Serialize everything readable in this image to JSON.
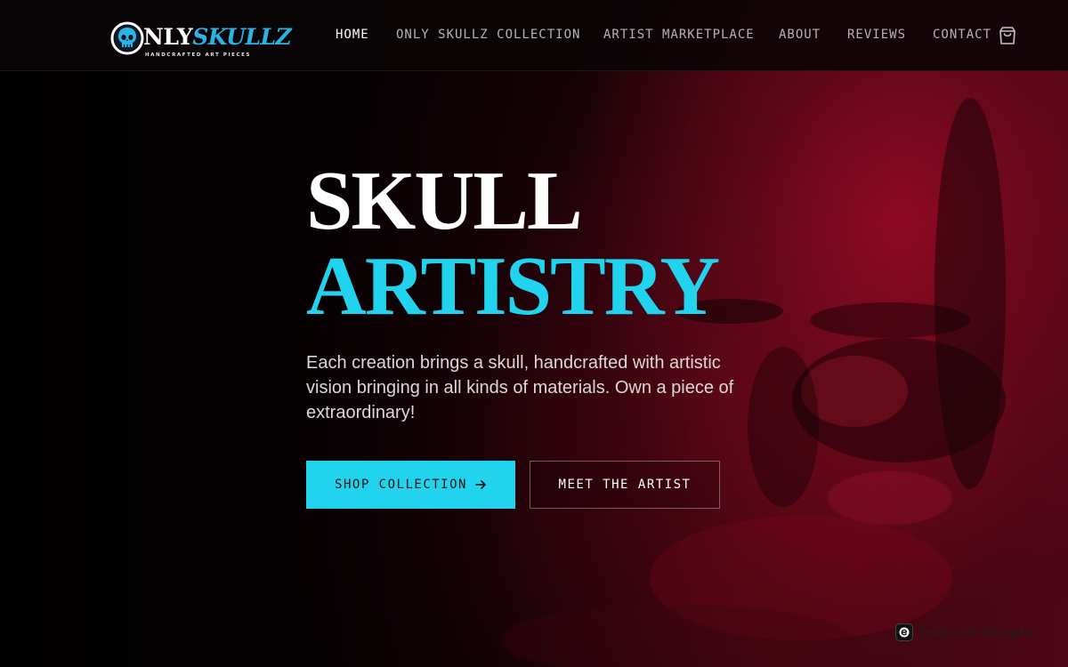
{
  "brand": {
    "name_part1": "NLY",
    "name_part2": "SKULLZ",
    "tagline": "HANDCRAFTED ART PIECES"
  },
  "nav": {
    "items": [
      {
        "label": "HOME",
        "active": true
      },
      {
        "label": "ONLY SKULLZ COLLECTION",
        "active": false
      },
      {
        "label": "ARTIST MARKETPLACE",
        "active": false
      },
      {
        "label": "ABOUT",
        "active": false
      },
      {
        "label": "REVIEWS",
        "active": false
      },
      {
        "label": "CONTACT",
        "active": false
      }
    ],
    "cart_icon": "shopping-bag-icon"
  },
  "hero": {
    "title_line1": "SKULL",
    "title_line2": "ARTISTRY",
    "description": "Each creation brings a skull, handcrafted with artistic vision bringing in all kinds of materials. Own a piece of extraordinary!",
    "primary_button": "SHOP COLLECTION",
    "primary_button_icon": "arrow-right-icon",
    "secondary_button": "MEET THE ARTIST"
  },
  "badge": {
    "text": "Made with Emergent"
  },
  "colors": {
    "accent": "#22d3ee",
    "logo_blue": "#2ab4e6",
    "background": "#050203",
    "hero_red": "#8a0a22"
  }
}
